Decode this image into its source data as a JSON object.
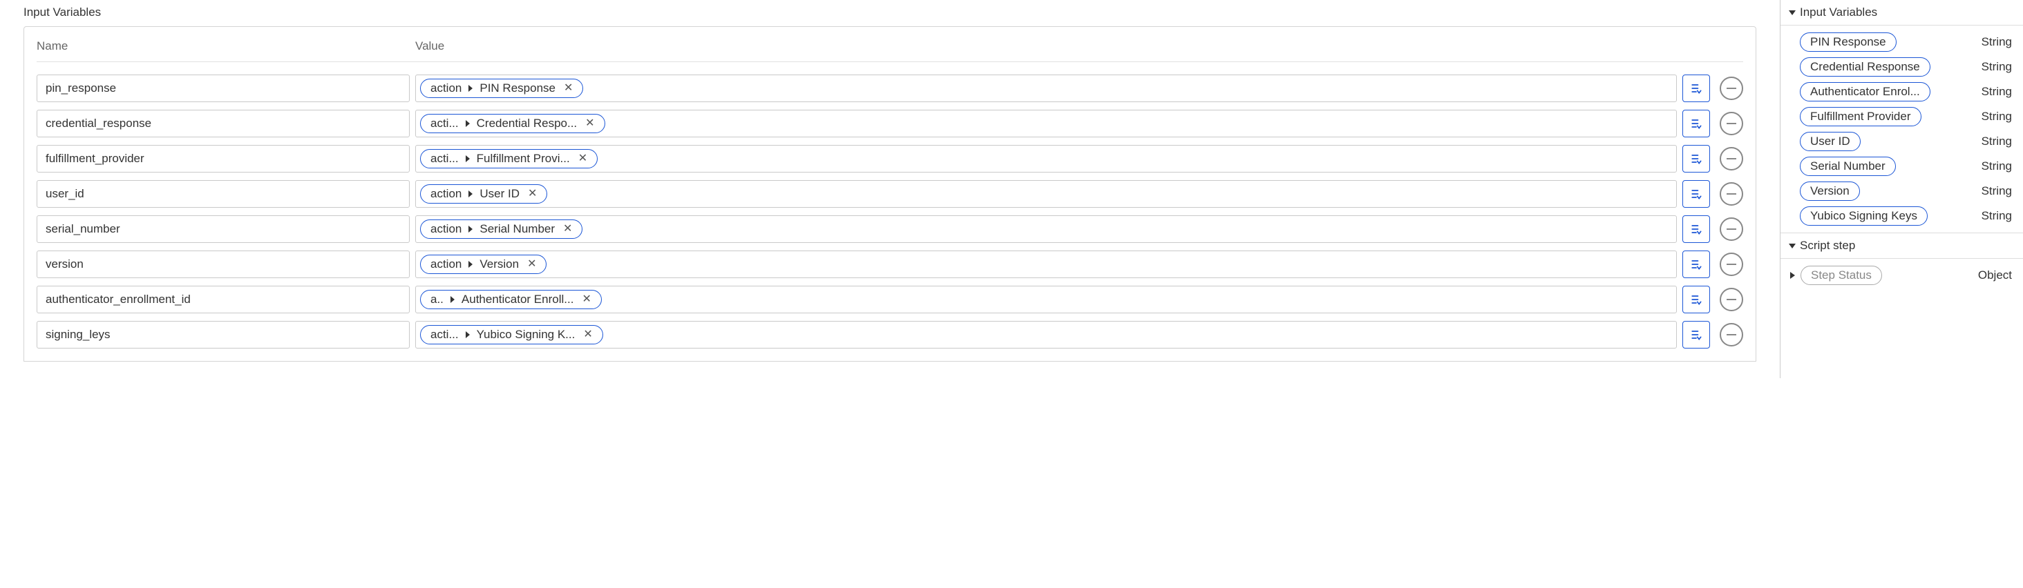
{
  "header": {
    "section_title": "Input Variables",
    "name_col": "Name",
    "value_col": "Value"
  },
  "rows": [
    {
      "name": "pin_response",
      "source": "action",
      "variable": "PIN Response"
    },
    {
      "name": "credential_response",
      "source": "acti...",
      "variable": "Credential Respo..."
    },
    {
      "name": "fulfillment_provider",
      "source": "acti...",
      "variable": "Fulfillment Provi..."
    },
    {
      "name": "user_id",
      "source": "action",
      "variable": "User ID"
    },
    {
      "name": "serial_number",
      "source": "action",
      "variable": "Serial Number"
    },
    {
      "name": "version",
      "source": "action",
      "variable": "Version"
    },
    {
      "name": "authenticator_enrollment_id",
      "source": "a..",
      "variable": "Authenticator Enroll..."
    },
    {
      "name": "signing_leys",
      "source": "acti...",
      "variable": "Yubico Signing K..."
    }
  ],
  "right_pane": {
    "section_input_vars": "Input Variables",
    "section_script_step": "Script step",
    "vars": [
      {
        "label": "PIN Response",
        "type": "String"
      },
      {
        "label": "Credential Response",
        "type": "String"
      },
      {
        "label": "Authenticator Enrol...",
        "type": "String"
      },
      {
        "label": "Fulfillment Provider",
        "type": "String"
      },
      {
        "label": "User ID",
        "type": "String"
      },
      {
        "label": "Serial Number",
        "type": "String"
      },
      {
        "label": "Version",
        "type": "String"
      },
      {
        "label": "Yubico Signing Keys",
        "type": "String"
      }
    ],
    "step_status": {
      "label": "Step Status",
      "type": "Object"
    }
  },
  "icons": {
    "picker_svg": "<svg viewBox='0 0 24 24' fill='none' stroke='#1b56d6' stroke-width='2' stroke-linecap='round'><path d='M5 6h10'/><path d='M5 12h10'/><path d='M5 18h7'/><path d='M20 16 l-3 4 l-3 -4'/></svg>"
  }
}
